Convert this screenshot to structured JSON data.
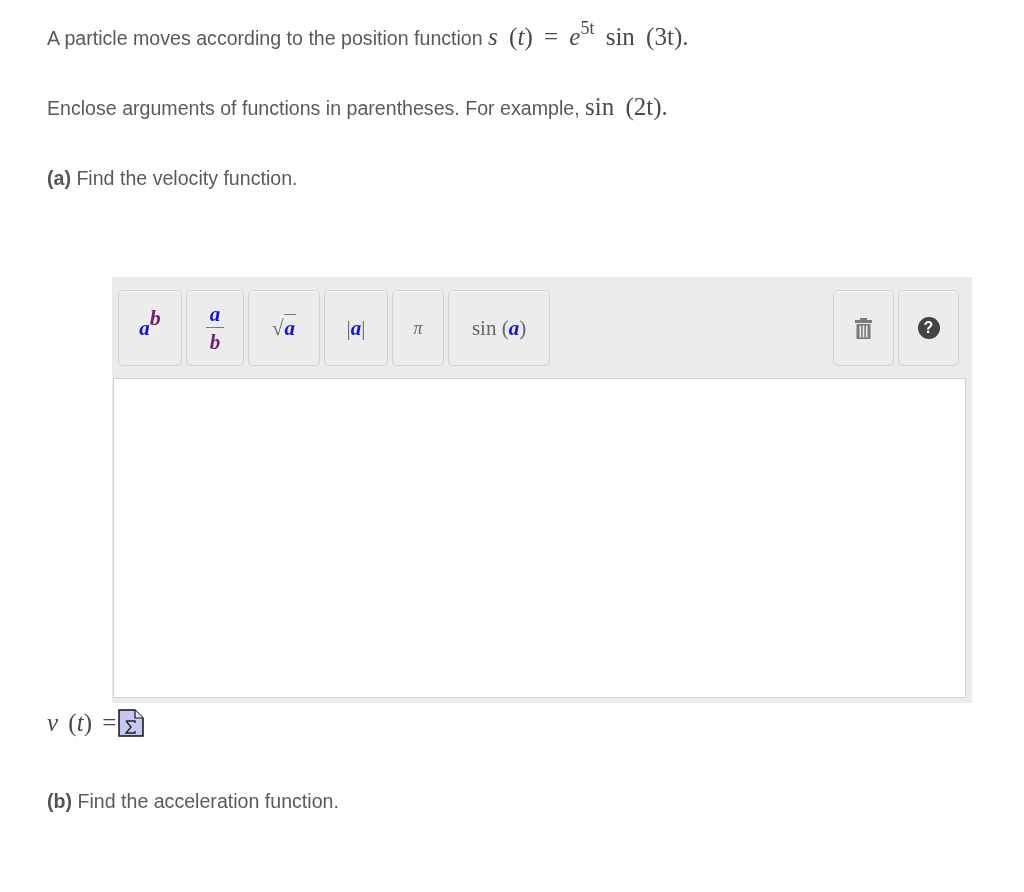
{
  "problem": {
    "text": "A particle moves according to the position function ",
    "math": "*s* (*t*) = *e*$^{5t}$ sin (3t)."
  },
  "instruction": {
    "text": "Enclose arguments of functions in parentheses. For example, ",
    "math": "sin (2t)."
  },
  "parts": [
    {
      "prompt": "**(a)** Find the velocity function.",
      "editor": {
        "toolbar": [
          {
            "kind": "power",
            "base": "a",
            "exponent": "b"
          },
          {
            "kind": "fraction",
            "numerator": "a",
            "denominator": "b"
          },
          {
            "kind": "sqrt",
            "prefix": "√",
            "argument": "a"
          },
          {
            "kind": "abs",
            "prefix": "|",
            "argument": "a",
            "suffix": "|"
          },
          {
            "kind": "symbol",
            "label": "π"
          },
          {
            "kind": "function",
            "prefix": "sin (",
            "argument": "a",
            "suffix": ")"
          }
        ],
        "tools": [
          {
            "kind": "trash"
          },
          {
            "kind": "help",
            "label": "?"
          }
        ]
      },
      "answer_label": "*v* (*t*) ="
    },
    {
      "prompt": "**(b)** Find the acceleration function."
    }
  ]
}
